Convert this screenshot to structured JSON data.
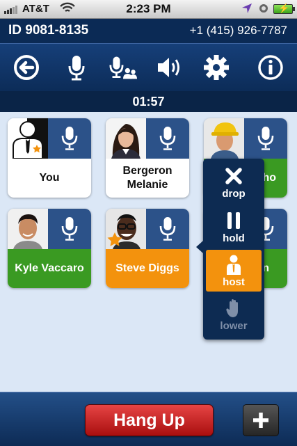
{
  "status_bar": {
    "carrier": "AT&T",
    "time": "2:23 PM"
  },
  "header": {
    "conference_id": "ID 9081-8135",
    "phone_number": "+1 (415) 926-7787"
  },
  "toolbar": {
    "icons": [
      "back-icon",
      "microphone-icon",
      "mute-all-icon",
      "speaker-icon",
      "settings-icon",
      "info-icon"
    ]
  },
  "timer": "01:57",
  "participants": [
    {
      "name": "You",
      "style": "white",
      "host": true
    },
    {
      "name": "Bergeron Melanie",
      "style": "white",
      "host": false
    },
    {
      "name": "...ho",
      "style": "green",
      "host": false
    },
    {
      "name": "Kyle Vaccaro",
      "style": "green",
      "host": false
    },
    {
      "name": "Steve Diggs",
      "style": "orange",
      "host": true
    },
    {
      "name": "...n",
      "style": "green",
      "host": false
    }
  ],
  "popup_menu": {
    "items": [
      {
        "label": "drop",
        "icon": "close-icon"
      },
      {
        "label": "hold",
        "icon": "pause-icon"
      },
      {
        "label": "host",
        "icon": "host-icon",
        "active": true
      },
      {
        "label": "lower",
        "icon": "hand-icon",
        "disabled": true
      }
    ]
  },
  "bottom_bar": {
    "hangup_label": "Hang Up",
    "add_label": "+"
  },
  "colors": {
    "header_bg": "#0b2a55",
    "card_green": "#3a9a22",
    "card_orange": "#f3920d",
    "mic_blue": "#2c5289",
    "hangup_red": "#c92020"
  }
}
